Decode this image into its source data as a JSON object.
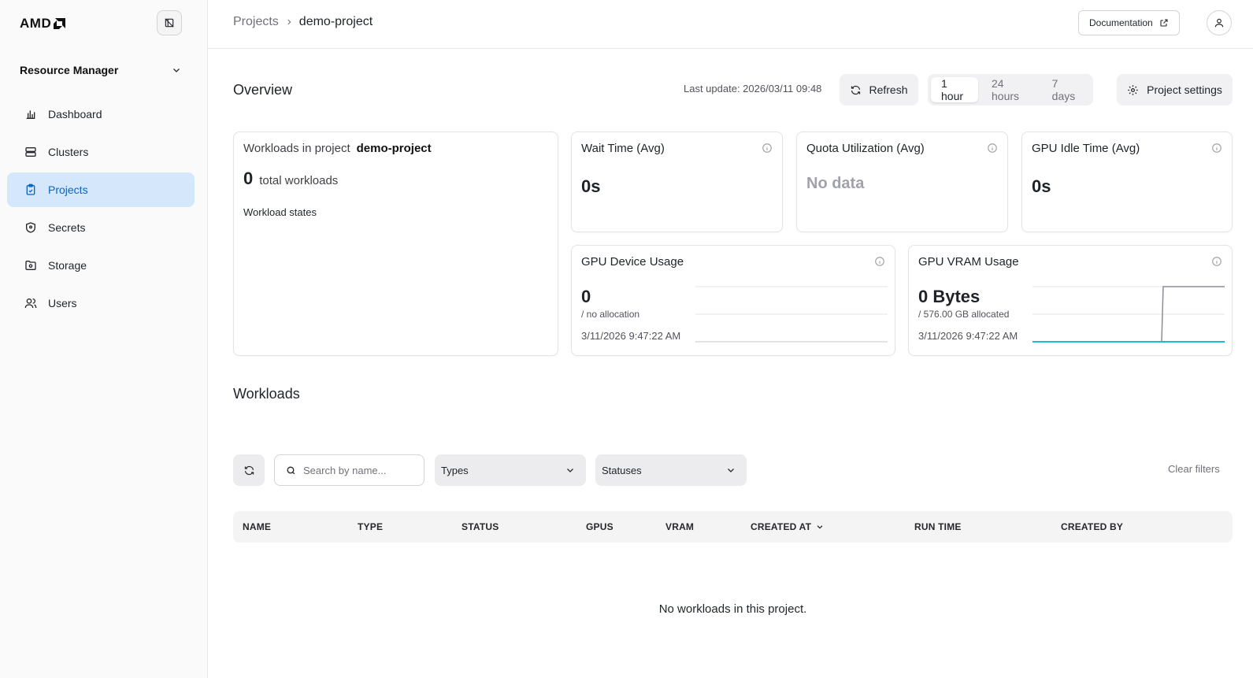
{
  "brand": {
    "logo_text": "AMD"
  },
  "sidebar": {
    "section_label": "Resource Manager",
    "items": [
      {
        "label": "Dashboard",
        "icon": "bar-chart-icon",
        "active": false
      },
      {
        "label": "Clusters",
        "icon": "server-icon",
        "active": false
      },
      {
        "label": "Projects",
        "icon": "clipboard-icon",
        "active": true
      },
      {
        "label": "Secrets",
        "icon": "shield-icon",
        "active": false
      },
      {
        "label": "Storage",
        "icon": "folder-icon",
        "active": false
      },
      {
        "label": "Users",
        "icon": "users-icon",
        "active": false
      }
    ]
  },
  "header": {
    "breadcrumb_parent": "Projects",
    "breadcrumb_current": "demo-project",
    "documentation_label": "Documentation"
  },
  "overview": {
    "title": "Overview",
    "last_update": "Last update: 2026/03/11 09:48",
    "refresh_label": "Refresh",
    "ranges": [
      "1 hour",
      "24 hours",
      "7 days"
    ],
    "selected_range": "1 hour",
    "settings_label": "Project settings"
  },
  "cards": {
    "workloads": {
      "title_prefix": "Workloads in project",
      "project": "demo-project",
      "count": "0",
      "count_label": "total workloads",
      "states_label": "Workload states"
    },
    "wait_time": {
      "title": "Wait Time (Avg)",
      "value": "0s"
    },
    "quota": {
      "title": "Quota Utilization (Avg)",
      "value": "No data"
    },
    "gpu_idle": {
      "title": "GPU Idle Time (Avg)",
      "value": "0s"
    },
    "gpu_device": {
      "title": "GPU Device Usage",
      "value": "0",
      "sub": "/ no allocation",
      "timestamp": "3/11/2026 9:47:22 AM"
    },
    "gpu_vram": {
      "title": "GPU VRAM Usage",
      "value": "0 Bytes",
      "sub": "/ 576.00 GB allocated",
      "timestamp": "3/11/2026 9:47:22 AM"
    }
  },
  "workloads": {
    "title": "Workloads",
    "search_placeholder": "Search by name...",
    "types_label": "Types",
    "statuses_label": "Statuses",
    "clear_filters": "Clear filters",
    "columns": [
      "NAME",
      "TYPE",
      "STATUS",
      "GPUS",
      "VRAM",
      "CREATED AT",
      "RUN TIME",
      "CREATED BY"
    ],
    "empty_message": "No workloads in this project."
  },
  "colors": {
    "accent": "#0b63c6",
    "active_bg": "#d5e7fb",
    "vram_used": "#22b8cf",
    "vram_alloc": "#8c8c96"
  }
}
